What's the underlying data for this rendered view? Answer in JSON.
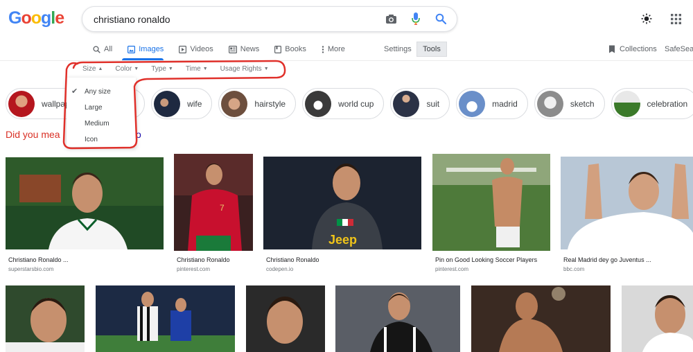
{
  "logo": {
    "letters": [
      "G",
      "o",
      "o",
      "g",
      "l",
      "e"
    ],
    "colors": [
      "#4285f4",
      "#ea4335",
      "#fbbc05",
      "#4285f4",
      "#34a853",
      "#ea4335"
    ]
  },
  "search": {
    "query": "christiano ronaldo"
  },
  "nav": {
    "tabs": [
      {
        "label": "All",
        "icon": "search-icon"
      },
      {
        "label": "Images",
        "icon": "image-icon",
        "active": true
      },
      {
        "label": "Videos",
        "icon": "video-icon"
      },
      {
        "label": "News",
        "icon": "news-icon"
      },
      {
        "label": "Books",
        "icon": "book-icon"
      },
      {
        "label": "More",
        "icon": "more-vert-icon"
      }
    ],
    "settings": "Settings",
    "tools": "Tools",
    "collections": "Collections",
    "safesearch": "SafeSear"
  },
  "filters": [
    "Size",
    "Color",
    "Type",
    "Time",
    "Usage Rights"
  ],
  "size_menu": {
    "options": [
      "Any size",
      "Large",
      "Medium",
      "Icon"
    ],
    "selected": "Any size"
  },
  "chips": [
    {
      "label": "wallpaper",
      "color": "#b5161e"
    },
    {
      "label": "e",
      "color": "#c8c8c8"
    },
    {
      "label": "wife",
      "color": "#1e2940"
    },
    {
      "label": "hairstyle",
      "color": "#6d4f3e"
    },
    {
      "label": "world cup",
      "color": "#3a3a3a"
    },
    {
      "label": "suit",
      "color": "#2b3246"
    },
    {
      "label": "madrid",
      "color": "#6a8fc9"
    },
    {
      "label": "sketch",
      "color": "#8c8c8c"
    },
    {
      "label": "celebration",
      "color": "#3b7a2a"
    }
  ],
  "did_you_mean": {
    "prefix": "Did you mea",
    "suffix": "o"
  },
  "results": [
    {
      "title": "Christiano Ronaldo ...",
      "source": "superstarsbio.com",
      "bg": "#2e5a2a",
      "accent": "#ffffff"
    },
    {
      "title": "Christiano Ronaldo",
      "source": "pinterest.com",
      "bg": "#6b1a1a",
      "accent": "#c8102e"
    },
    {
      "title": "Christiano Ronaldo",
      "source": "codepen.io",
      "bg": "#1c2330",
      "accent": "#3a3f47"
    },
    {
      "title": "Pin on Good Looking Soccer Players",
      "source": "pinterest.com",
      "bg": "#4e7a3a",
      "accent": "#c58b65"
    },
    {
      "title": "Real Madrid dey go Juventus ...",
      "source": "bbc.com",
      "bg": "#b8c7d6",
      "accent": "#ffffff"
    }
  ],
  "row2": [
    {
      "bg": "#2f4a2d"
    },
    {
      "bg": "#3f7e3a"
    },
    {
      "bg": "#2a2a2a"
    },
    {
      "bg": "#5a5e66"
    },
    {
      "bg": "#3a2a22"
    },
    {
      "bg": "#d9d9d9"
    }
  ]
}
